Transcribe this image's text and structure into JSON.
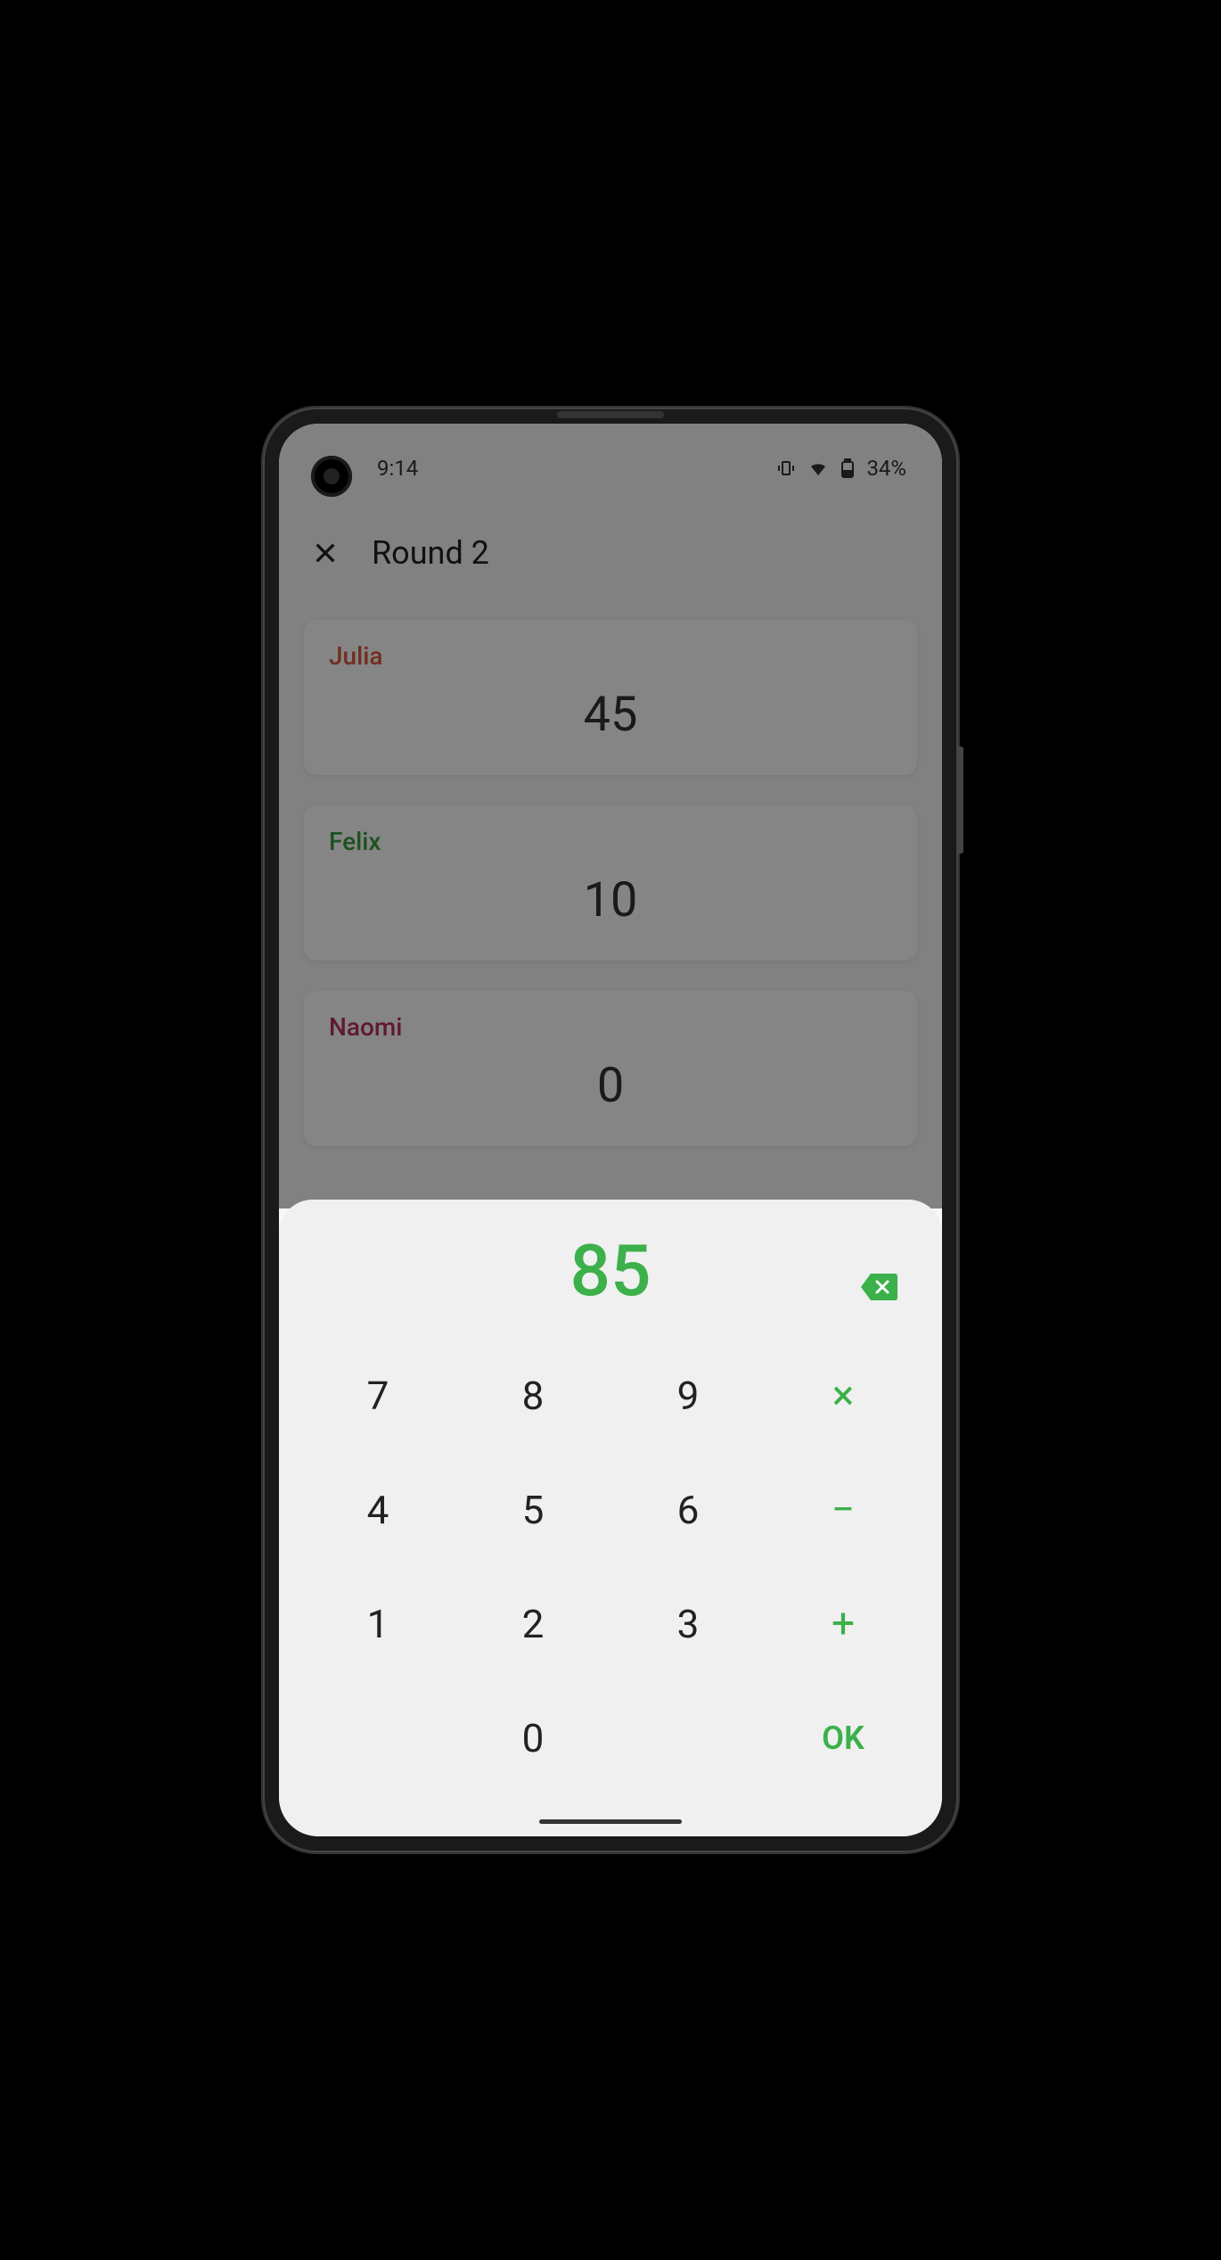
{
  "status": {
    "time": "9:14",
    "battery_text": "34%"
  },
  "header": {
    "title": "Round 2"
  },
  "players": [
    {
      "name": "Julia",
      "color": "#d95b3a",
      "score": "45"
    },
    {
      "name": "Felix",
      "color": "#3a9c3e",
      "score": "10"
    },
    {
      "name": "Naomi",
      "color": "#b83258",
      "score": "0"
    }
  ],
  "keypad": {
    "display": "85",
    "keys": {
      "7": "7",
      "8": "8",
      "9": "9",
      "4": "4",
      "5": "5",
      "6": "6",
      "1": "1",
      "2": "2",
      "3": "3",
      "0": "0",
      "multiply": "×",
      "minus": "−",
      "plus": "+",
      "ok": "OK"
    }
  }
}
